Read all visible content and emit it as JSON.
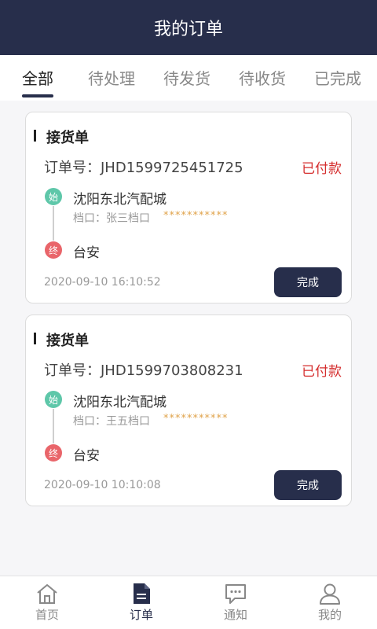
{
  "header": {
    "title": "我的订单"
  },
  "tabs": [
    {
      "label": "全部",
      "active": true
    },
    {
      "label": "待处理",
      "active": false
    },
    {
      "label": "待发货",
      "active": false
    },
    {
      "label": "待收货",
      "active": false
    },
    {
      "label": "已完成",
      "active": false
    }
  ],
  "orders": [
    {
      "title": "接货单",
      "order_no": "订单号：JHD1599725451725",
      "status": "已付款",
      "start_marker": "始",
      "from": "沈阳东北汽配城",
      "stall": "档口：张三档口",
      "stall_phone": "***********",
      "end_marker": "终",
      "to": "台安",
      "time": "2020-09-10 16:10:52",
      "action": "完成"
    },
    {
      "title": "接货单",
      "order_no": "订单号：JHD1599703808231",
      "status": "已付款",
      "start_marker": "始",
      "from": "沈阳东北汽配城",
      "stall": "档口：王五档口",
      "stall_phone": "***********",
      "end_marker": "终",
      "to": "台安",
      "time": "2020-09-10 10:10:08",
      "action": "完成"
    }
  ],
  "bottom_nav": [
    {
      "label": "首页",
      "icon": "home-icon",
      "active": false
    },
    {
      "label": "订单",
      "icon": "order-icon",
      "active": true
    },
    {
      "label": "通知",
      "icon": "chat-icon",
      "active": false
    },
    {
      "label": "我的",
      "icon": "user-icon",
      "active": false
    }
  ],
  "colors": {
    "primary": "#272e4b",
    "paid": "#d52e2e",
    "start": "#5ec7a9",
    "end": "#e9656a",
    "phone": "#e0a34b"
  }
}
